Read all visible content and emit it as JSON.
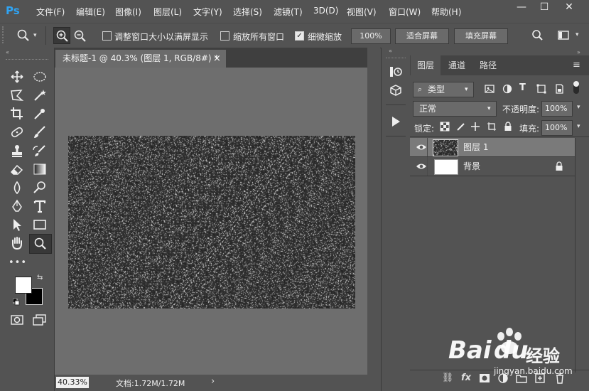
{
  "app": {
    "logo": "Ps"
  },
  "menu": [
    "文件(F)",
    "编辑(E)",
    "图像(I)",
    "图层(L)",
    "文字(Y)",
    "选择(S)",
    "滤镜(T)",
    "3D(D)",
    "视图(V)",
    "窗口(W)",
    "帮助(H)"
  ],
  "window_controls": {
    "minimize": "—",
    "maximize": "☐",
    "close": "✕"
  },
  "options": {
    "resize_windows_label": "调整窗口大小以满屏显示",
    "zoom_all_label": "缩放所有窗口",
    "scrubby_label": "细微缩放",
    "scrubby_checked": true,
    "zoom_value": "100%",
    "fit_screen": "适合屏幕",
    "fill_screen": "填充屏幕"
  },
  "document": {
    "tab_title": "未标题-1 @ 40.3% (图层 1, RGB/8#) *",
    "tab_close": "×",
    "zoom_status": "40.33%",
    "doc_size": "文档:1.72M/1.72M",
    "status_arrow": "›"
  },
  "layers_panel": {
    "tabs": [
      "图层",
      "通道",
      "路径"
    ],
    "filter_kind": "类型",
    "blend_mode": "正常",
    "opacity_label": "不透明度:",
    "opacity_value": "100%",
    "lock_label": "锁定:",
    "fill_label": "填充:",
    "fill_value": "100%",
    "layers": [
      {
        "name": "图层 1",
        "selected": true,
        "locked": false
      },
      {
        "name": "背景",
        "selected": false,
        "locked": true
      }
    ]
  },
  "watermark": {
    "brand": "Bai",
    "brand2": "du",
    "cn": "经验",
    "url": "jingyan.baidu.com"
  },
  "colors": {
    "ui_bg": "#535353",
    "canvas_bg": "#6e6e6e",
    "selected_row": "#7a7a7a",
    "ps_blue": "#2fa4f4"
  }
}
